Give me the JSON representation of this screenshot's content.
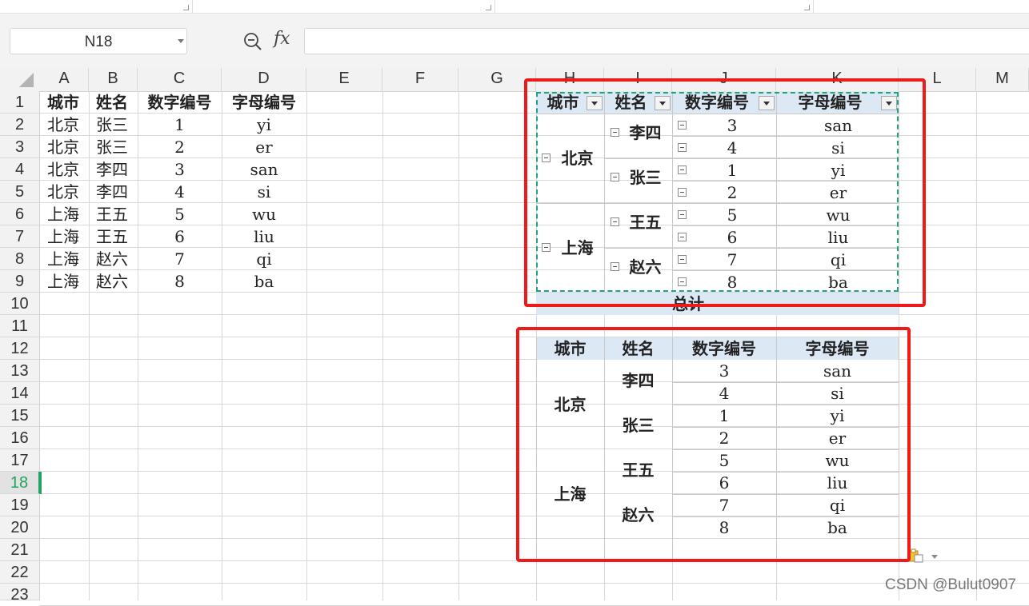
{
  "formula_bar": {
    "name_box": "N18",
    "fx_label": "fx",
    "formula": ""
  },
  "columns": [
    "A",
    "B",
    "C",
    "D",
    "E",
    "F",
    "G",
    "H",
    "I",
    "J",
    "K",
    "L",
    "M"
  ],
  "rows": [
    "1",
    "2",
    "3",
    "4",
    "5",
    "6",
    "7",
    "8",
    "9",
    "10",
    "11",
    "12",
    "13",
    "14",
    "15",
    "16",
    "17",
    "18",
    "19",
    "20",
    "21",
    "22",
    "23"
  ],
  "selected_row": "18",
  "source_table": {
    "headers": [
      "城市",
      "姓名",
      "数字编号",
      "字母编号"
    ],
    "rows": [
      [
        "北京",
        "张三",
        "1",
        "yi"
      ],
      [
        "北京",
        "张三",
        "2",
        "er"
      ],
      [
        "北京",
        "李四",
        "3",
        "san"
      ],
      [
        "北京",
        "李四",
        "4",
        "si"
      ],
      [
        "上海",
        "王五",
        "5",
        "wu"
      ],
      [
        "上海",
        "王五",
        "6",
        "liu"
      ],
      [
        "上海",
        "赵六",
        "7",
        "qi"
      ],
      [
        "上海",
        "赵六",
        "8",
        "ba"
      ]
    ]
  },
  "pivot": {
    "headers": [
      "城市",
      "姓名",
      "数字编号",
      "字母编号"
    ],
    "cities": [
      "北京",
      "上海"
    ],
    "names": [
      "李四",
      "张三",
      "王五",
      "赵六"
    ],
    "numbers": [
      "3",
      "4",
      "1",
      "2",
      "5",
      "6",
      "7",
      "8"
    ],
    "letters": [
      "san",
      "si",
      "yi",
      "er",
      "wu",
      "liu",
      "qi",
      "ba"
    ],
    "total_label": "总计"
  },
  "copy_table": {
    "headers": [
      "城市",
      "姓名",
      "数字编号",
      "字母编号"
    ],
    "cities": [
      "北京",
      "上海"
    ],
    "names": [
      "李四",
      "张三",
      "王五",
      "赵六"
    ],
    "numbers": [
      "3",
      "4",
      "1",
      "2",
      "5",
      "6",
      "7",
      "8"
    ],
    "letters": [
      "san",
      "si",
      "yi",
      "er",
      "wu",
      "liu",
      "qi",
      "ba"
    ]
  },
  "watermark": "CSDN @Bulut0907",
  "colors": {
    "header_bg": "#f2f2f2",
    "pivot_header": "#dce9f5",
    "highlight_red": "#ee1a1a",
    "selection_green": "#21a366"
  }
}
